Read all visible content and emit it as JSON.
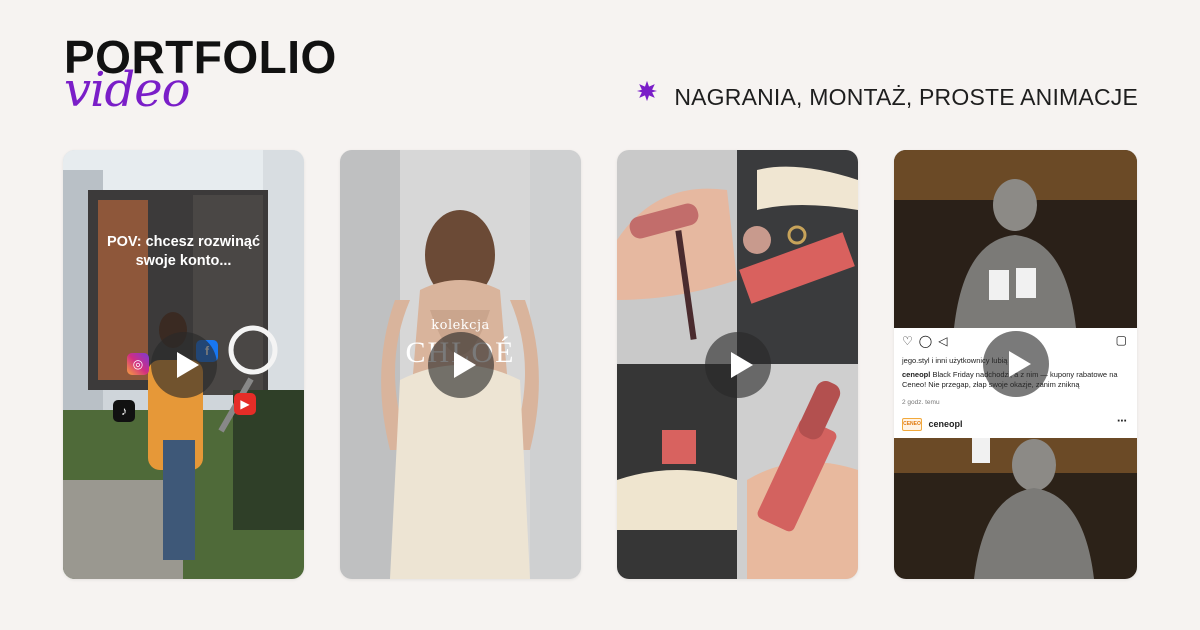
{
  "header": {
    "title": "PORTFOLIO",
    "script": "video",
    "tagline": "NAGRANIA, MONTAŻ, PROSTE ANIMACJE"
  },
  "colors": {
    "accent": "#7a1ec8",
    "background": "#f6f3f1"
  },
  "cards": [
    {
      "overlay_text_line1": "POV: chcesz rozwinąć",
      "overlay_text_line2": "swoje konto..."
    },
    {
      "kolekcja": "kolekcja",
      "brand": "CHLOÉ"
    },
    {},
    {
      "ig_user_line": "jego.styl i inni użytkownicy lubią to",
      "caption_user": "ceneopl",
      "caption_text": "Black Friday nadchodzi, a z nim — kupony rabatowe na Ceneo! Nie przegap, złap swoje okazje, zanim znikną",
      "time": "2 godz. temu",
      "account": "ceneopl",
      "logo": "CENEO"
    }
  ],
  "icons": {
    "tagline_star": "purple-star-icon",
    "play": "play-icon"
  }
}
